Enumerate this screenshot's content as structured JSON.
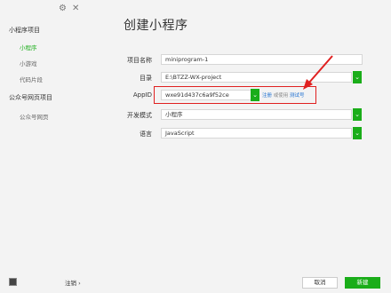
{
  "sidebar": {
    "sections": [
      {
        "label": "小程序项目",
        "items": [
          {
            "label": "小程序",
            "active": true
          },
          {
            "label": "小游戏",
            "active": false
          },
          {
            "label": "代码片段",
            "active": false
          }
        ]
      },
      {
        "label": "公众号网页项目",
        "items": [
          {
            "label": "公众号网页",
            "active": false
          }
        ]
      }
    ],
    "logout_label": "注销 ›",
    "settings_icon": "gear-icon",
    "close_icon": "close-icon"
  },
  "main": {
    "title": "创建小程序",
    "fields": {
      "project_name": {
        "label": "项目名称",
        "value": "miniprogram-1"
      },
      "directory": {
        "label": "目录",
        "value": "E:\\BTZZ-WX-project"
      },
      "appid": {
        "label": "AppID",
        "value": "wxe91d437c6a9f52ce",
        "link_register": "注册",
        "link_or_use": "或使用",
        "link_test": "测试号"
      },
      "dev_mode": {
        "label": "开发模式",
        "value": "小程序"
      },
      "language": {
        "label": "语言",
        "value": "JavaScript"
      }
    },
    "buttons": {
      "cancel": "取消",
      "create": "新建"
    }
  },
  "colors": {
    "accent": "#1aad19",
    "highlight": "#e02020",
    "link": "#1a6dd1"
  }
}
